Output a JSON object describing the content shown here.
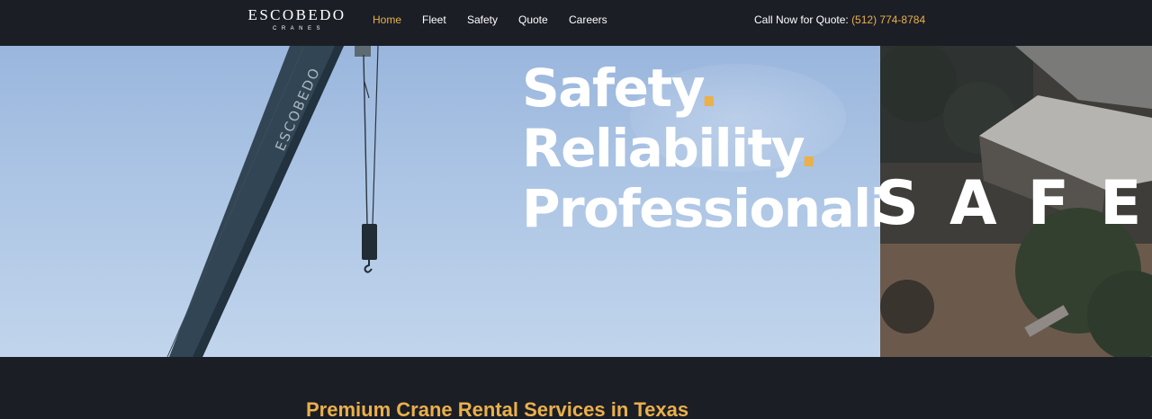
{
  "header": {
    "logo_main": "ESCOBEDO",
    "logo_sub": "CRANES",
    "nav": [
      {
        "label": "Home",
        "active": true
      },
      {
        "label": "Fleet",
        "active": false
      },
      {
        "label": "Safety",
        "active": false
      },
      {
        "label": "Quote",
        "active": false
      },
      {
        "label": "Careers",
        "active": false
      }
    ],
    "call_label": "Call Now for Quote:",
    "phone": "(512) 774-8784"
  },
  "hero": {
    "crane_brand": "ESCOBEDO",
    "headline": [
      "Safety",
      "Reliability",
      "Professionalism"
    ],
    "headline_dot": ".",
    "overlay_word": "SAFE"
  },
  "section": {
    "title": "Premium Crane Rental Services in Texas"
  },
  "colors": {
    "accent": "#e9b04b",
    "background": "#1c1e26"
  }
}
